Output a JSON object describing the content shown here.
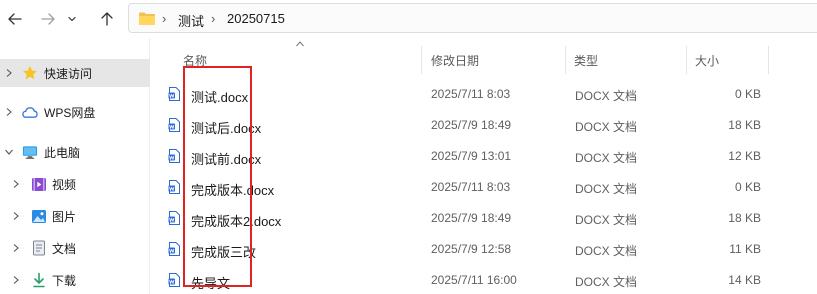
{
  "nav": {
    "back_icon": "arrow-left-icon",
    "forward_icon": "arrow-right-icon",
    "recent_icon": "chevron-down-icon",
    "up_icon": "arrow-up-icon"
  },
  "address": {
    "folder_icon": "folder-icon",
    "separator": "›",
    "crumbs": [
      "测试",
      "20250715"
    ]
  },
  "sidebar": {
    "items": [
      {
        "label": "快速访问",
        "icon": "star-icon",
        "selected": true
      },
      {
        "label": "WPS网盘",
        "icon": "cloud-icon",
        "selected": false
      },
      {
        "label": "此电脑",
        "icon": "monitor-icon",
        "selected": false,
        "expanded": true
      },
      {
        "label": "视频",
        "icon": "video-icon",
        "selected": false
      },
      {
        "label": "图片",
        "icon": "picture-icon",
        "selected": false
      },
      {
        "label": "文档",
        "icon": "document-icon",
        "selected": false
      },
      {
        "label": "下载",
        "icon": "download-icon",
        "selected": false
      }
    ]
  },
  "columns": {
    "name": "名称",
    "modified": "修改日期",
    "type": "类型",
    "size": "大小"
  },
  "files": [
    {
      "name": "测试.docx",
      "modified": "2025/7/11 8:03",
      "type": "DOCX 文档",
      "size": "0 KB"
    },
    {
      "name": "测试后.docx",
      "modified": "2025/7/9 18:49",
      "type": "DOCX 文档",
      "size": "18 KB"
    },
    {
      "name": "测试前.docx",
      "modified": "2025/7/9 13:01",
      "type": "DOCX 文档",
      "size": "12 KB"
    },
    {
      "name": "完成版本.docx",
      "modified": "2025/7/11 8:03",
      "type": "DOCX 文档",
      "size": "0 KB"
    },
    {
      "name": "完成版本2.docx",
      "modified": "2025/7/9 18:49",
      "type": "DOCX 文档",
      "size": "18 KB"
    },
    {
      "name": "完成版三改",
      "modified": "2025/7/9 12:58",
      "type": "DOCX 文档",
      "size": "11 KB"
    },
    {
      "name": "先导文",
      "modified": "2025/7/11 16:00",
      "type": "DOCX 文档",
      "size": "14 KB"
    }
  ],
  "colors": {
    "highlight_box": "#e02424",
    "selected_bg": "#e6e6e6",
    "word_icon": "#2b6cd4"
  }
}
